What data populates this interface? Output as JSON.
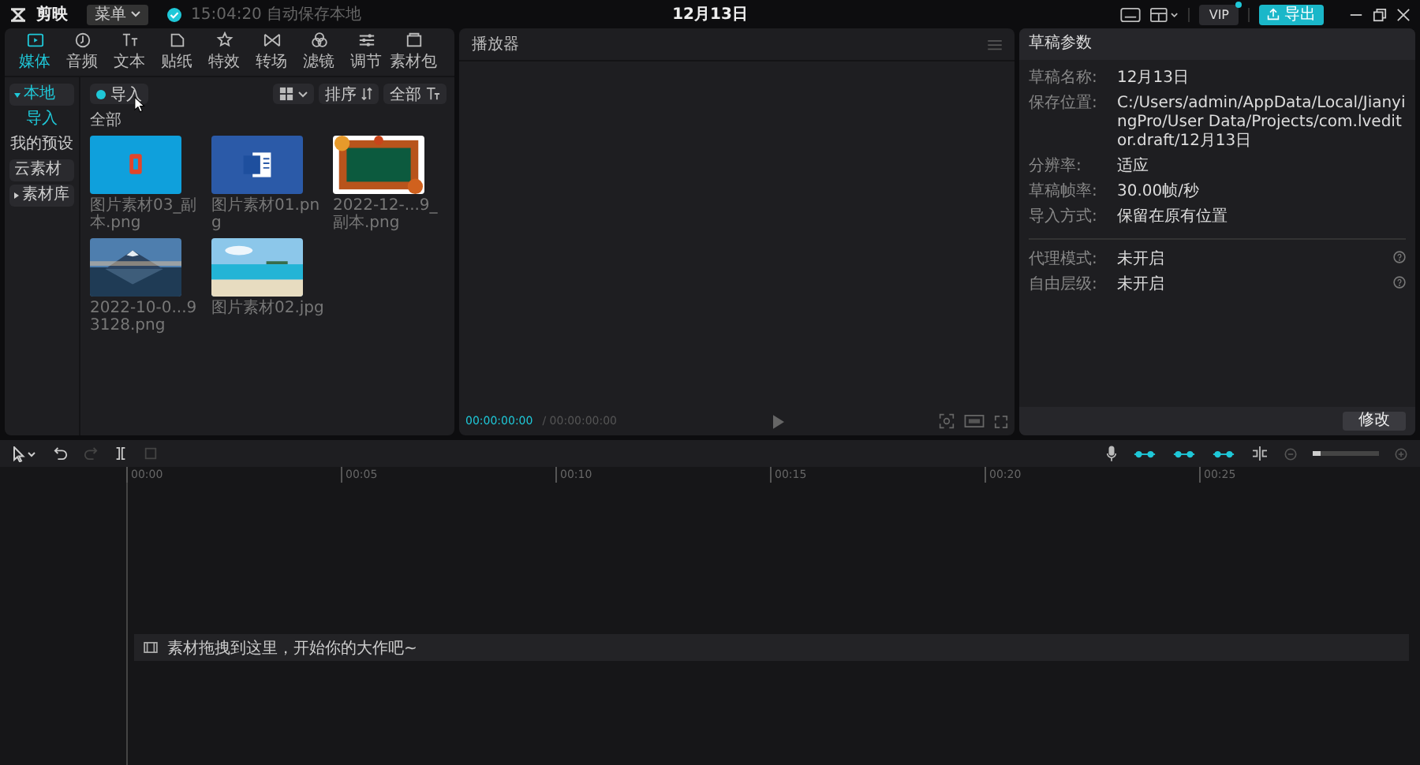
{
  "app": {
    "logo": "剪映",
    "menu": "菜单",
    "autosave": "15:04:20 自动保存本地",
    "title": "12月13日",
    "vip": "VIP",
    "export": "导出"
  },
  "media_tabs": [
    {
      "label": "媒体",
      "selected": true
    },
    {
      "label": "音频",
      "selected": false
    },
    {
      "label": "文本",
      "selected": false
    },
    {
      "label": "贴纸",
      "selected": false
    },
    {
      "label": "特效",
      "selected": false
    },
    {
      "label": "转场",
      "selected": false
    },
    {
      "label": "滤镜",
      "selected": false
    },
    {
      "label": "调节",
      "selected": false
    },
    {
      "label": "素材包",
      "selected": false
    }
  ],
  "sidebar": [
    {
      "label": "本地",
      "expanded": true,
      "children": [
        {
          "label": "导入",
          "selected": true
        },
        {
          "label": "我的预设",
          "selected": false
        }
      ]
    },
    {
      "label": "云素材"
    },
    {
      "label": "素材库",
      "expanded": false
    }
  ],
  "media_toolbar": {
    "import": "导入",
    "sort": "排序",
    "filter": "全部"
  },
  "section": "全部",
  "media": [
    {
      "name": "图片素材03_副本.png"
    },
    {
      "name": "图片素材01.png"
    },
    {
      "name": "2022-12-...9_副本.png"
    },
    {
      "name": "2022-10-0...93128.png"
    },
    {
      "name": "图片素材02.jpg"
    }
  ],
  "player": {
    "title": "播放器",
    "current": "00:00:00:00",
    "total": "/ 00:00:00:00"
  },
  "draft": {
    "title": "草稿参数",
    "groups": [
      [
        {
          "label": "草稿名称:",
          "value": "12月13日",
          "help": false
        },
        {
          "label": "保存位置:",
          "value": "C:/Users/admin/AppData/Local/JianyingPro/User Data/Projects/com.lveditor.draft/12月13日",
          "help": false
        },
        {
          "label": "分辨率:",
          "value": "适应",
          "help": false
        },
        {
          "label": "草稿帧率:",
          "value": "30.00帧/秒",
          "help": false
        },
        {
          "label": "导入方式:",
          "value": "保留在原有位置",
          "help": false
        }
      ],
      [
        {
          "label": "代理模式:",
          "value": "未开启",
          "help": true
        },
        {
          "label": "自由层级:",
          "value": "未开启",
          "help": true
        }
      ]
    ],
    "button": "修改"
  },
  "timeline": {
    "tools": [
      {
        "kind": "select",
        "disabled": false
      },
      {
        "kind": "undo",
        "disabled": false
      },
      {
        "kind": "redo",
        "disabled": true
      },
      {
        "kind": "split",
        "disabled": false
      },
      {
        "kind": "delete",
        "disabled": true
      }
    ],
    "toggles": [
      {
        "on": true
      },
      {
        "on": true
      },
      {
        "on": true
      }
    ],
    "zoom": {
      "level": 0.12
    },
    "ticks": [
      "00:00",
      "00:05",
      "00:10",
      "00:15",
      "00:20",
      "00:25"
    ],
    "hint": "素材拖拽到这里，开始你的大作吧~"
  }
}
